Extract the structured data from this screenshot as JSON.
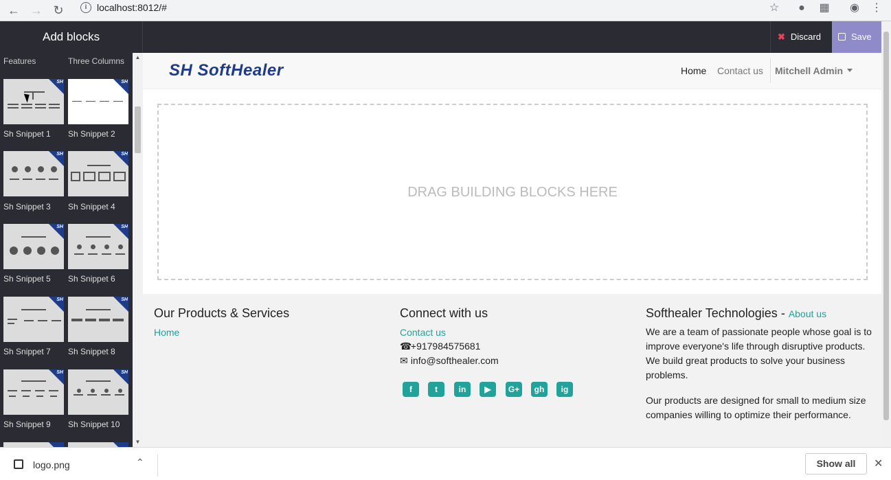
{
  "browser": {
    "url": "localhost:8012/#",
    "back_icon": "arrow-left-icon",
    "forward_icon": "arrow-right-icon",
    "reload_icon": "reload-icon",
    "info_icon": "i"
  },
  "editor": {
    "sidebar_title": "Add blocks",
    "discard_label": "Discard",
    "save_label": "Save",
    "discard_color": "#e0455a",
    "save_color": "#8f8ac9"
  },
  "sidebar": {
    "col_headers": [
      "Features",
      "Three Columns"
    ],
    "snippets": [
      {
        "label": "Sh Snippet 1"
      },
      {
        "label": "Sh Snippet 2"
      },
      {
        "label": "Sh Snippet 3"
      },
      {
        "label": "Sh Snippet 4"
      },
      {
        "label": "Sh Snippet 5"
      },
      {
        "label": "Sh Snippet 6"
      },
      {
        "label": "Sh Snippet 7"
      },
      {
        "label": "Sh Snippet 8"
      },
      {
        "label": "Sh Snippet 9"
      },
      {
        "label": "Sh Snippet 10"
      }
    ]
  },
  "site": {
    "logo_text": "SoftHealer",
    "nav": {
      "home": "Home",
      "contact": "Contact us",
      "user": "Mitchell Admin"
    },
    "drop_zone_text": "DRAG BUILDING BLOCKS HERE",
    "footer": {
      "col1_title": "Our Products & Services",
      "col1_link": "Home",
      "col2_title": "Connect with us",
      "col2_link": "Contact us",
      "phone": "+917984575681",
      "email": "info@softhealer.com",
      "col3_title": "Softhealer Technologies",
      "col3_sep": " - ",
      "col3_link": "About us",
      "para1": "We are a team of passionate people whose goal is to improve everyone's life through disruptive products. We build great products to solve your business problems.",
      "para2": "Our products are designed for small to medium size companies willing to optimize their performance.",
      "social": [
        "f",
        "t",
        "in",
        "▶",
        "G+",
        "gh",
        "ig"
      ]
    }
  },
  "download": {
    "filename": "logo.png",
    "show_all": "Show all"
  },
  "colors": {
    "accent": "#21a29a",
    "brand": "#1f3c88",
    "editor_bg": "#2b2c33"
  }
}
